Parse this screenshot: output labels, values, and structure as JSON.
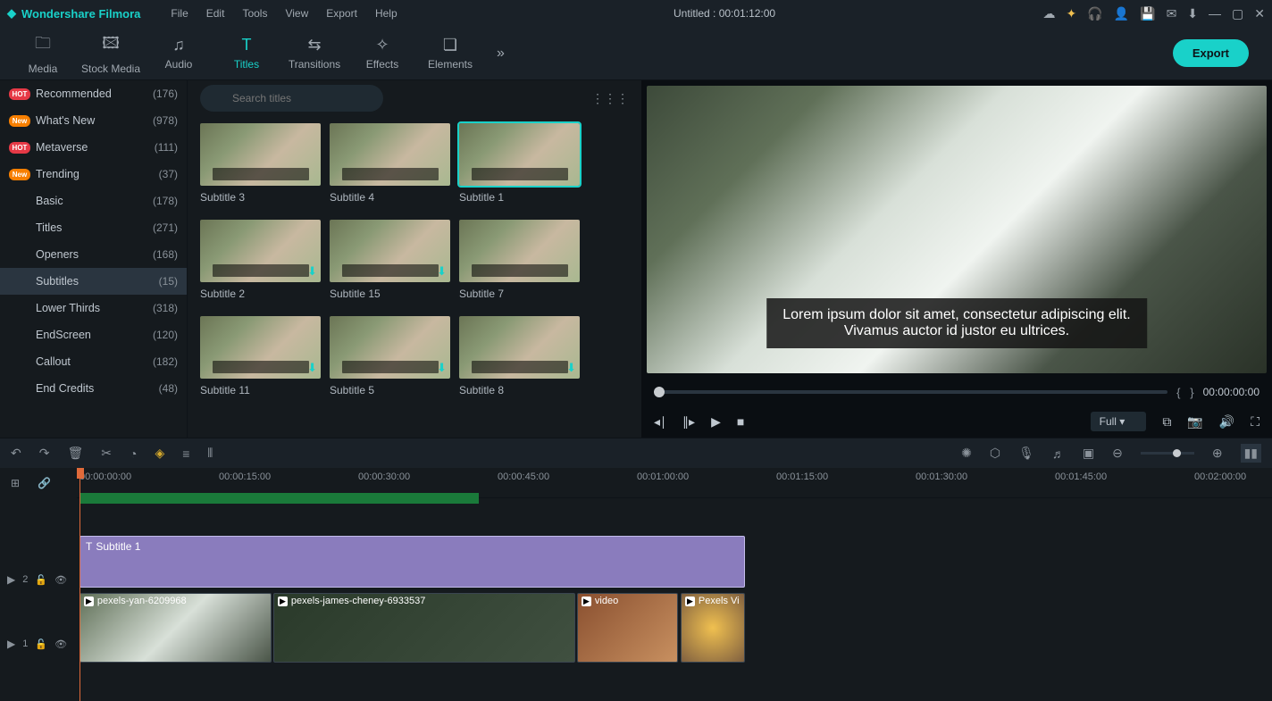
{
  "titlebar": {
    "app_name": "Wondershare Filmora",
    "menus": [
      "File",
      "Edit",
      "Tools",
      "View",
      "Export",
      "Help"
    ],
    "document_title": "Untitled : 00:01:12:00"
  },
  "toolbar": {
    "tabs": [
      {
        "label": "Media",
        "icon": "▭"
      },
      {
        "label": "Stock Media",
        "icon": "🖼"
      },
      {
        "label": "Audio",
        "icon": "♪"
      },
      {
        "label": "Titles",
        "icon": "T",
        "active": true
      },
      {
        "label": "Transitions",
        "icon": "⇄"
      },
      {
        "label": "Effects",
        "icon": "✦"
      },
      {
        "label": "Elements",
        "icon": "⬚"
      }
    ],
    "export_label": "Export"
  },
  "sidebar": {
    "items": [
      {
        "badge": "HOT",
        "badge_class": "hot",
        "name": "Recommended",
        "count": "(176)"
      },
      {
        "badge": "New",
        "badge_class": "new",
        "name": "What's New",
        "count": "(978)"
      },
      {
        "badge": "HOT",
        "badge_class": "hot",
        "name": "Metaverse",
        "count": "(111)"
      },
      {
        "badge": "New",
        "badge_class": "new",
        "name": "Trending",
        "count": "(37)"
      },
      {
        "badge": "",
        "badge_class": "empty",
        "name": "Basic",
        "count": "(178)"
      },
      {
        "badge": "",
        "badge_class": "empty",
        "name": "Titles",
        "count": "(271)"
      },
      {
        "badge": "",
        "badge_class": "empty",
        "name": "Openers",
        "count": "(168)"
      },
      {
        "badge": "",
        "badge_class": "empty",
        "name": "Subtitles",
        "count": "(15)",
        "selected": true
      },
      {
        "badge": "",
        "badge_class": "empty",
        "name": "Lower Thirds",
        "count": "(318)"
      },
      {
        "badge": "",
        "badge_class": "empty",
        "name": "EndScreen",
        "count": "(120)"
      },
      {
        "badge": "",
        "badge_class": "empty",
        "name": "Callout",
        "count": "(182)"
      },
      {
        "badge": "",
        "badge_class": "empty",
        "name": "End Credits",
        "count": "(48)"
      }
    ]
  },
  "browse": {
    "search_placeholder": "Search titles",
    "thumbs": [
      {
        "label": "Subtitle 3"
      },
      {
        "label": "Subtitle 4"
      },
      {
        "label": "Subtitle 1",
        "selected": true
      },
      {
        "label": "Subtitle 2",
        "downloadable": true
      },
      {
        "label": "Subtitle 15",
        "downloadable": true
      },
      {
        "label": "Subtitle 7"
      },
      {
        "label": "Subtitle 11",
        "downloadable": true
      },
      {
        "label": "Subtitle 5",
        "downloadable": true
      },
      {
        "label": "Subtitle 8",
        "downloadable": true
      }
    ]
  },
  "preview": {
    "subtitle_line1": "Lorem ipsum dolor sit amet, consectetur adipiscing elit.",
    "subtitle_line2": "Vivamus auctor id justor eu ultrices.",
    "timecode": "00:00:00:00",
    "quality": "Full"
  },
  "timeline": {
    "ruler": [
      "00:00:00:00",
      "00:00:15:00",
      "00:00:30:00",
      "00:00:45:00",
      "00:01:00:00",
      "00:01:15:00",
      "00:01:30:00",
      "00:01:45:00",
      "00:02:00:00"
    ],
    "track2_label": "2",
    "track1_label": "1",
    "subtitle_clip_label": "Subtitle 1",
    "clips": [
      {
        "label": "pexels-yan-6209968"
      },
      {
        "label": "pexels-james-cheney-6933537"
      },
      {
        "label": "video"
      },
      {
        "label": "Pexels Vi"
      }
    ]
  }
}
